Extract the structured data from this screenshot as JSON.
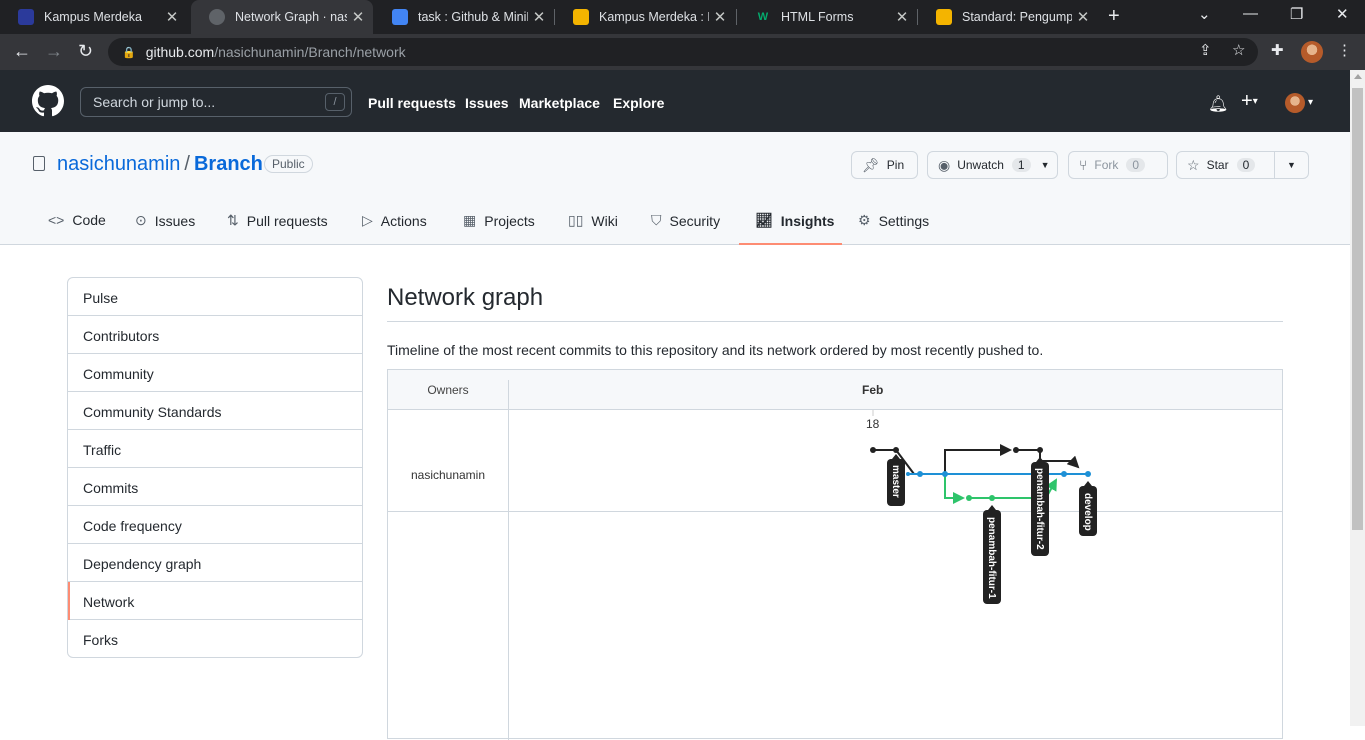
{
  "browser": {
    "tabs": [
      {
        "title": "Kampus Merdeka",
        "icon": "kampus-merdeka-icon",
        "color": "#2b3a9b"
      },
      {
        "title": "Network Graph · nasic",
        "icon": "github-icon",
        "color": "#35363a",
        "active": true
      },
      {
        "title": "task : Github & MiniPr",
        "icon": "docs-icon",
        "color": "#4285f4"
      },
      {
        "title": "Kampus Merdeka : HT",
        "icon": "slides-icon",
        "color": "#f4b400"
      },
      {
        "title": "HTML Forms",
        "icon": "w3schools-icon",
        "color": "#04aa6d"
      },
      {
        "title": "Standard: Pengumpul",
        "icon": "slides-icon",
        "color": "#f4b400"
      }
    ],
    "url_host": "github.com",
    "url_path": "/nasichunamin/Branch/network"
  },
  "gh_header": {
    "search_placeholder": "Search or jump to...",
    "search_key": "/",
    "nav": [
      "Pull requests",
      "Issues",
      "Marketplace",
      "Explore"
    ]
  },
  "repo": {
    "owner": "nasichunamin",
    "separator": "/",
    "name": "Branch",
    "visibility": "Public",
    "pin_label": "Pin",
    "watch_label": "Unwatch",
    "watch_count": "1",
    "fork_label": "Fork",
    "fork_count": "0",
    "star_label": "Star",
    "star_count": "0",
    "tabs": [
      "Code",
      "Issues",
      "Pull requests",
      "Actions",
      "Projects",
      "Wiki",
      "Security",
      "Insights",
      "Settings"
    ]
  },
  "sidebar": {
    "items": [
      "Pulse",
      "Contributors",
      "Community",
      "Community Standards",
      "Traffic",
      "Commits",
      "Code frequency",
      "Dependency graph",
      "Network",
      "Forks"
    ],
    "selected": "Network"
  },
  "main": {
    "title": "Network graph",
    "description": "Timeline of the most recent commits to this repository and its network ordered by most recently pushed to.",
    "owners_header": "Owners",
    "month": "Feb",
    "day": "18",
    "owner": "nasichunamin",
    "branches": [
      "master",
      "penambah-fitur-1",
      "penambah-fitur-2",
      "develop"
    ],
    "colors": {
      "black": "#222222",
      "blue": "#1e90d6",
      "green": "#2ec46b"
    }
  }
}
